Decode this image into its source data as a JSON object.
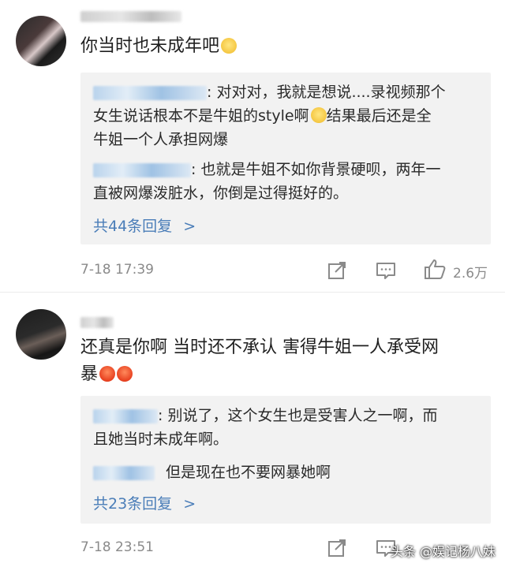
{
  "comments": [
    {
      "text": "你当时也未成年吧",
      "emoji": "slight-smile",
      "replies": [
        {
          "line1": ": 对对对，我就是想说....录视频那个",
          "line2": "女生说话根本不是牛姐的style啊",
          "line2_emoji": "sweat-smile",
          "line2_tail": "结果最后还是全",
          "line3": "牛姐一个人承担网爆"
        },
        {
          "line1": ": 也就是牛姐不如你背景硬呗，两年一",
          "line2": "直被网爆泼脏水，你倒是过得挺好的。"
        }
      ],
      "more_replies": "共44条回复",
      "more_arrow": ">",
      "time": "7-18 17:39",
      "likes": "2.6万"
    },
    {
      "text_line1": "还真是你啊 当时还不承认 害得牛姐一人承受网",
      "text_line2": "暴",
      "emoji": "angry",
      "replies": [
        {
          "line1": ": 别说了，这个女生也是受害人之一啊，而",
          "line2": "且她当时未成年啊。"
        },
        {
          "line1": "但是现在也不要网暴她啊"
        }
      ],
      "more_replies": "共23条回复",
      "more_arrow": ">",
      "time": "7-18 23:51"
    }
  ],
  "watermark": "头条 @娱记杨八妹"
}
